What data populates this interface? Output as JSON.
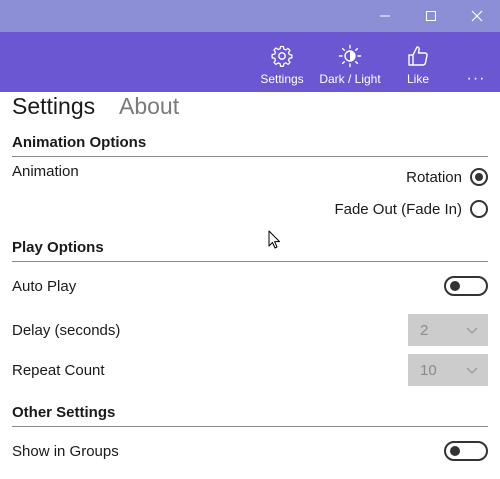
{
  "window": {
    "controls": [
      "minimize",
      "maximize",
      "close"
    ]
  },
  "appbar": {
    "buttons": [
      {
        "label": "Settings",
        "icon": "gear-icon"
      },
      {
        "label": "Dark / Light",
        "icon": "brightness-icon"
      },
      {
        "label": "Like",
        "icon": "thumbs-up-icon"
      }
    ],
    "more": "···"
  },
  "tabs": {
    "settings": "Settings",
    "about": "About"
  },
  "animation": {
    "heading": "Animation Options",
    "label": "Animation",
    "options": [
      {
        "label": "Rotation",
        "selected": true
      },
      {
        "label": "Fade Out (Fade In)",
        "selected": false
      }
    ]
  },
  "play": {
    "heading": "Play Options",
    "auto_play_label": "Auto Play",
    "auto_play_on": false,
    "delay_label": "Delay (seconds)",
    "delay_value": "2",
    "repeat_label": "Repeat Count",
    "repeat_value": "10"
  },
  "other": {
    "heading": "Other Settings",
    "groups_label": "Show in Groups",
    "groups_on": false
  },
  "colors": {
    "titlebar": "#8c8fd6",
    "appbar": "#6b57d1",
    "disabled_select": "#cccccc"
  }
}
